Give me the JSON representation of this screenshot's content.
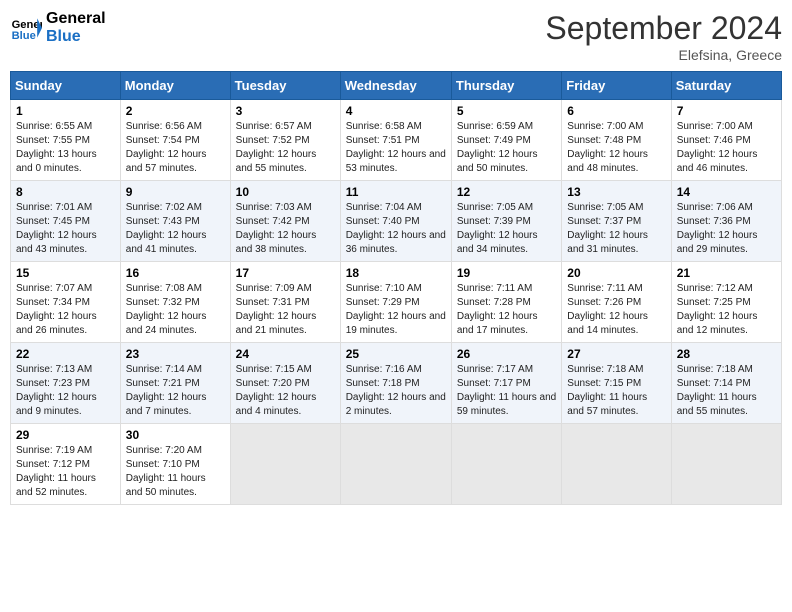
{
  "header": {
    "logo_line1": "General",
    "logo_line2": "Blue",
    "month_title": "September 2024",
    "location": "Elefsina, Greece"
  },
  "days_of_week": [
    "Sunday",
    "Monday",
    "Tuesday",
    "Wednesday",
    "Thursday",
    "Friday",
    "Saturday"
  ],
  "weeks": [
    [
      {
        "day": "1",
        "sunrise": "6:55 AM",
        "sunset": "7:55 PM",
        "daylight": "13 hours and 0 minutes."
      },
      {
        "day": "2",
        "sunrise": "6:56 AM",
        "sunset": "7:54 PM",
        "daylight": "12 hours and 57 minutes."
      },
      {
        "day": "3",
        "sunrise": "6:57 AM",
        "sunset": "7:52 PM",
        "daylight": "12 hours and 55 minutes."
      },
      {
        "day": "4",
        "sunrise": "6:58 AM",
        "sunset": "7:51 PM",
        "daylight": "12 hours and 53 minutes."
      },
      {
        "day": "5",
        "sunrise": "6:59 AM",
        "sunset": "7:49 PM",
        "daylight": "12 hours and 50 minutes."
      },
      {
        "day": "6",
        "sunrise": "7:00 AM",
        "sunset": "7:48 PM",
        "daylight": "12 hours and 48 minutes."
      },
      {
        "day": "7",
        "sunrise": "7:00 AM",
        "sunset": "7:46 PM",
        "daylight": "12 hours and 46 minutes."
      }
    ],
    [
      {
        "day": "8",
        "sunrise": "7:01 AM",
        "sunset": "7:45 PM",
        "daylight": "12 hours and 43 minutes."
      },
      {
        "day": "9",
        "sunrise": "7:02 AM",
        "sunset": "7:43 PM",
        "daylight": "12 hours and 41 minutes."
      },
      {
        "day": "10",
        "sunrise": "7:03 AM",
        "sunset": "7:42 PM",
        "daylight": "12 hours and 38 minutes."
      },
      {
        "day": "11",
        "sunrise": "7:04 AM",
        "sunset": "7:40 PM",
        "daylight": "12 hours and 36 minutes."
      },
      {
        "day": "12",
        "sunrise": "7:05 AM",
        "sunset": "7:39 PM",
        "daylight": "12 hours and 34 minutes."
      },
      {
        "day": "13",
        "sunrise": "7:05 AM",
        "sunset": "7:37 PM",
        "daylight": "12 hours and 31 minutes."
      },
      {
        "day": "14",
        "sunrise": "7:06 AM",
        "sunset": "7:36 PM",
        "daylight": "12 hours and 29 minutes."
      }
    ],
    [
      {
        "day": "15",
        "sunrise": "7:07 AM",
        "sunset": "7:34 PM",
        "daylight": "12 hours and 26 minutes."
      },
      {
        "day": "16",
        "sunrise": "7:08 AM",
        "sunset": "7:32 PM",
        "daylight": "12 hours and 24 minutes."
      },
      {
        "day": "17",
        "sunrise": "7:09 AM",
        "sunset": "7:31 PM",
        "daylight": "12 hours and 21 minutes."
      },
      {
        "day": "18",
        "sunrise": "7:10 AM",
        "sunset": "7:29 PM",
        "daylight": "12 hours and 19 minutes."
      },
      {
        "day": "19",
        "sunrise": "7:11 AM",
        "sunset": "7:28 PM",
        "daylight": "12 hours and 17 minutes."
      },
      {
        "day": "20",
        "sunrise": "7:11 AM",
        "sunset": "7:26 PM",
        "daylight": "12 hours and 14 minutes."
      },
      {
        "day": "21",
        "sunrise": "7:12 AM",
        "sunset": "7:25 PM",
        "daylight": "12 hours and 12 minutes."
      }
    ],
    [
      {
        "day": "22",
        "sunrise": "7:13 AM",
        "sunset": "7:23 PM",
        "daylight": "12 hours and 9 minutes."
      },
      {
        "day": "23",
        "sunrise": "7:14 AM",
        "sunset": "7:21 PM",
        "daylight": "12 hours and 7 minutes."
      },
      {
        "day": "24",
        "sunrise": "7:15 AM",
        "sunset": "7:20 PM",
        "daylight": "12 hours and 4 minutes."
      },
      {
        "day": "25",
        "sunrise": "7:16 AM",
        "sunset": "7:18 PM",
        "daylight": "12 hours and 2 minutes."
      },
      {
        "day": "26",
        "sunrise": "7:17 AM",
        "sunset": "7:17 PM",
        "daylight": "11 hours and 59 minutes."
      },
      {
        "day": "27",
        "sunrise": "7:18 AM",
        "sunset": "7:15 PM",
        "daylight": "11 hours and 57 minutes."
      },
      {
        "day": "28",
        "sunrise": "7:18 AM",
        "sunset": "7:14 PM",
        "daylight": "11 hours and 55 minutes."
      }
    ],
    [
      {
        "day": "29",
        "sunrise": "7:19 AM",
        "sunset": "7:12 PM",
        "daylight": "11 hours and 52 minutes."
      },
      {
        "day": "30",
        "sunrise": "7:20 AM",
        "sunset": "7:10 PM",
        "daylight": "11 hours and 50 minutes."
      },
      null,
      null,
      null,
      null,
      null
    ]
  ]
}
